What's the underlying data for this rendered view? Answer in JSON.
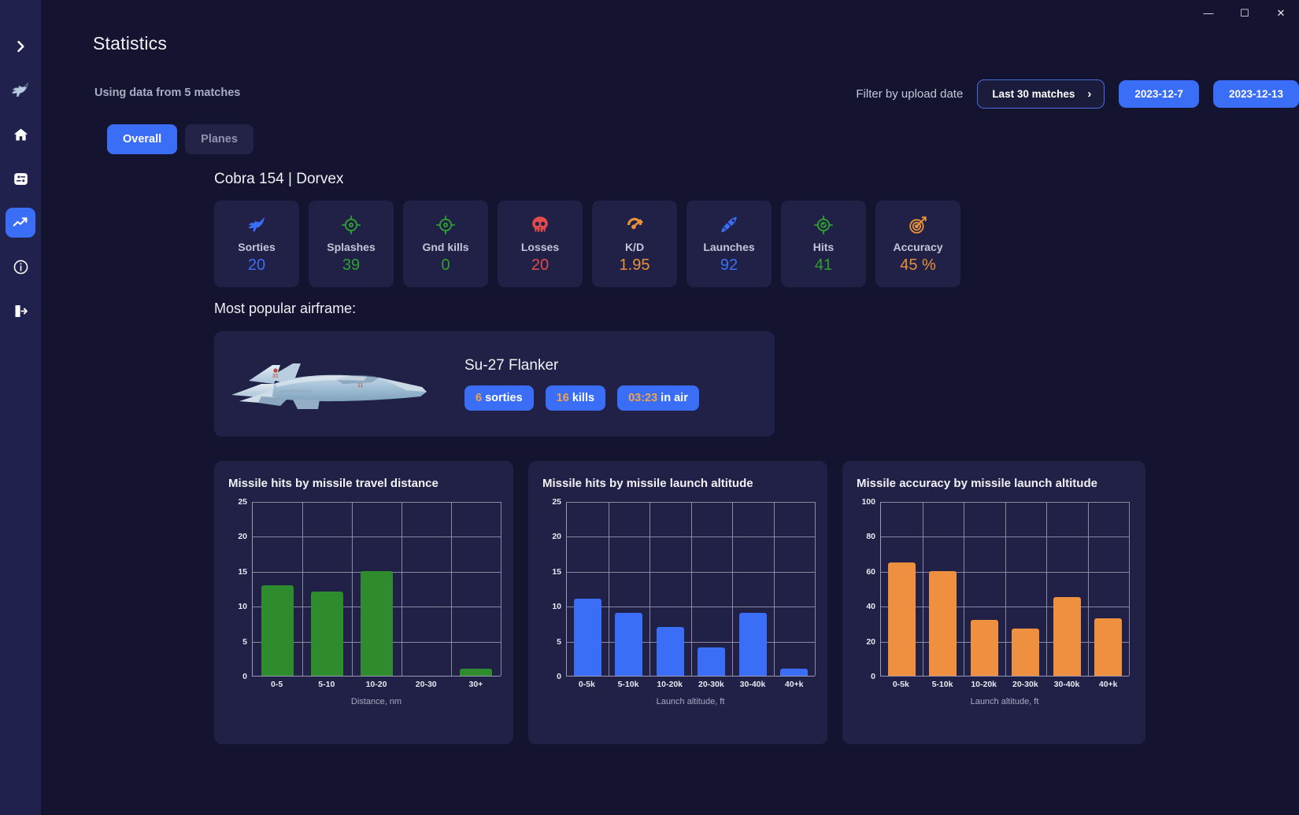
{
  "window": {
    "minimize": "—",
    "maximize": "☐",
    "close": "✕"
  },
  "sidebar": {
    "items": [
      {
        "name": "expand-sidebar",
        "icon": "chevron-right-icon",
        "active": false
      },
      {
        "name": "aircraft",
        "icon": "jet-fighter-icon",
        "active": false
      },
      {
        "name": "home",
        "icon": "home-icon",
        "active": false
      },
      {
        "name": "logs",
        "icon": "list-settings-icon",
        "active": false
      },
      {
        "name": "statistics",
        "icon": "trending-up-icon",
        "active": true
      },
      {
        "name": "about",
        "icon": "info-circle-icon",
        "active": false
      },
      {
        "name": "logout",
        "icon": "logout-icon",
        "active": false
      }
    ]
  },
  "header": {
    "title": "Statistics",
    "subtitle": "Using data from 5 matches",
    "filter_label": "Filter by upload date",
    "filter_dropdown": "Last 30 matches",
    "chevron": "›",
    "date_buttons": [
      "2023-12-7",
      "2023-12-13"
    ]
  },
  "tabs": [
    {
      "label": "Overall",
      "active": true
    },
    {
      "label": "Planes",
      "active": false
    }
  ],
  "player": {
    "name": "Cobra 154 | Dorvex"
  },
  "stats": [
    {
      "label": "Sorties",
      "value": "20",
      "icon": "jet-icon",
      "color": "v-blue",
      "icon_color": "#3b6ef6"
    },
    {
      "label": "Splashes",
      "value": "39",
      "icon": "crosshair-icon",
      "color": "v-green",
      "icon_color": "#2ea12e"
    },
    {
      "label": "Gnd kills",
      "value": "0",
      "icon": "crosshair-icon",
      "color": "v-green",
      "icon_color": "#2ea12e"
    },
    {
      "label": "Losses",
      "value": "20",
      "icon": "skull-icon",
      "color": "v-red",
      "icon_color": "#e34b4b"
    },
    {
      "label": "K/D",
      "value": "1.95",
      "icon": "gauge-icon",
      "color": "v-orange",
      "icon_color": "#e8903a"
    },
    {
      "label": "Launches",
      "value": "92",
      "icon": "missile-icon",
      "color": "v-blue",
      "icon_color": "#3b6ef6"
    },
    {
      "label": "Hits",
      "value": "41",
      "icon": "target-check-icon",
      "color": "v-green",
      "icon_color": "#2ea12e"
    },
    {
      "label": "Accuracy",
      "value": "45 %",
      "icon": "dartboard-icon",
      "color": "v-orange",
      "icon_color": "#e8903a"
    }
  ],
  "airframe": {
    "section_label": "Most popular airframe:",
    "name": "Su-27 Flanker",
    "chips": [
      {
        "num": "6",
        "text": " sorties"
      },
      {
        "num": "16",
        "text": " kills"
      },
      {
        "num": "03:23",
        "text": " in air"
      }
    ]
  },
  "chart_data": [
    {
      "type": "bar",
      "title": "Missile hits by missile travel distance",
      "categories": [
        "0-5",
        "5-10",
        "10-20",
        "20-30",
        "30+"
      ],
      "values": [
        13,
        12,
        15,
        0,
        1
      ],
      "yticks": [
        0,
        5,
        10,
        15,
        20,
        25
      ],
      "ylim": [
        0,
        25
      ],
      "xlabel": "Distance, nm",
      "ylabel": "",
      "color": "#2e8b2e",
      "grid": true,
      "legend": "none"
    },
    {
      "type": "bar",
      "title": "Missile hits by missile launch altitude",
      "categories": [
        "0-5k",
        "5-10k",
        "10-20k",
        "20-30k",
        "30-40k",
        "40+k"
      ],
      "values": [
        11,
        9,
        7,
        4,
        9,
        1
      ],
      "yticks": [
        0,
        5,
        10,
        15,
        20,
        25
      ],
      "ylim": [
        0,
        25
      ],
      "xlabel": "Launch altitude, ft",
      "ylabel": "",
      "color": "#3b6ef6",
      "grid": true,
      "legend": "none"
    },
    {
      "type": "bar",
      "title": "Missile accuracy by missile launch altitude",
      "categories": [
        "0-5k",
        "5-10k",
        "10-20k",
        "20-30k",
        "30-40k",
        "40+k"
      ],
      "values": [
        65,
        60,
        32,
        27,
        45,
        33
      ],
      "yticks": [
        0,
        20,
        40,
        60,
        80,
        100
      ],
      "ylim": [
        0,
        100
      ],
      "xlabel": "Launch altitude, ft",
      "ylabel": "",
      "color": "#ef9040",
      "grid": true,
      "legend": "none"
    }
  ]
}
